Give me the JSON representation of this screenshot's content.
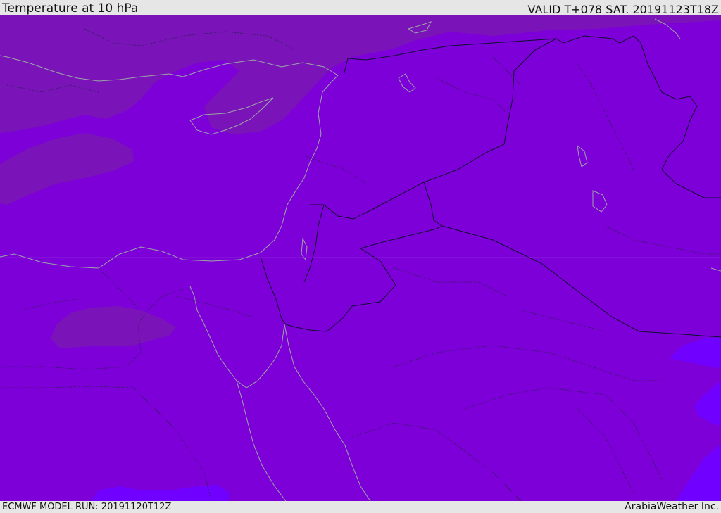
{
  "header": {
    "title": "Temperature at 10 hPa",
    "valid": "VALID T+078 SAT. 20191123T18Z"
  },
  "footer": {
    "model_run": "ECMWF MODEL RUN: 20191120T12Z",
    "credit": "ArabiaWeather Inc."
  },
  "map": {
    "region": "Eastern Mediterranean and Middle East",
    "field": "temperature",
    "level": "10 hPa",
    "colors": {
      "base_fill": "#7e00d8",
      "colder_band": "#7a14b8",
      "warmer_band": "#7000ff",
      "coastline": "#9aa6a6",
      "country_border": "#101030",
      "province_border": "#3a1b6a"
    },
    "layers": [
      "filled-temperature-contours",
      "coastlines",
      "country-borders",
      "province-borders"
    ]
  }
}
